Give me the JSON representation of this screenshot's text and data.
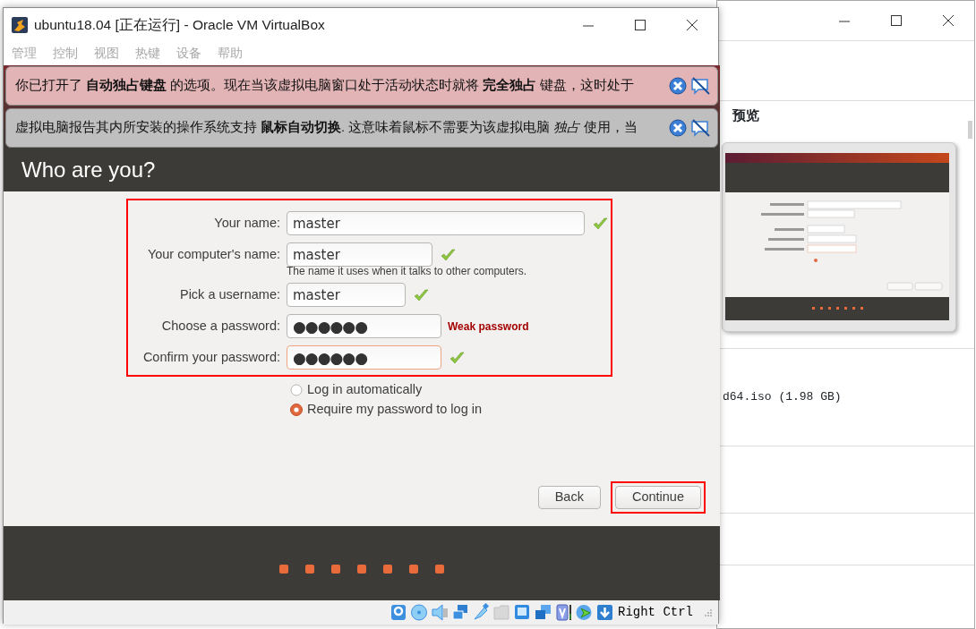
{
  "manager_window": {
    "preview_heading": "预览",
    "details_text": "d64.iso (1.98 GB)"
  },
  "vm_window": {
    "title": "ubuntu18.04 [正在运行] - Oracle VM VirtualBox",
    "menu": [
      "管理",
      "控制",
      "视图",
      "热键",
      "设备",
      "帮助"
    ],
    "guest": {
      "notifications": [
        {
          "text": "你已打开了 **自动独占键盘** 的选项。现在当该虚拟电脑窗口处于活动状态时就将 **完全独占** 键盘，这时处于",
          "color": "#e2b4b6"
        },
        {
          "text": "虚拟电脑报告其内所安装的操作系统支持 **鼠标自动切换**. 这意味着鼠标不需要为该虚拟电脑 *独占* 使用，当",
          "color": "#bfbfbf"
        }
      ],
      "page_title": "Who are you?",
      "fields": [
        {
          "label": "Your name:",
          "value": "master",
          "kind": "text",
          "valid": true,
          "focused": false
        },
        {
          "label": "Your computer's name:",
          "value": "master",
          "kind": "text",
          "valid": true,
          "focused": false,
          "hint": "The name it uses when it talks to other computers."
        },
        {
          "label": "Pick a username:",
          "value": "master",
          "kind": "text",
          "valid": true,
          "focused": false
        },
        {
          "label": "Choose a password:",
          "value": "●●●●●●",
          "kind": "password",
          "valid": false,
          "focused": false,
          "strength": "Weak password"
        },
        {
          "label": "Confirm your password:",
          "value": "●●●●●●",
          "kind": "password",
          "valid": true,
          "focused": true
        }
      ],
      "login_options": [
        {
          "label": "Log in automatically",
          "selected": false
        },
        {
          "label": "Require my password to log in",
          "selected": true
        }
      ],
      "buttons": [
        {
          "label": "Back",
          "annotated": false
        },
        {
          "label": "Continue",
          "annotated": true
        }
      ],
      "form_annotated": true
    },
    "status_bar": {
      "host_key": "Right Ctrl"
    }
  }
}
